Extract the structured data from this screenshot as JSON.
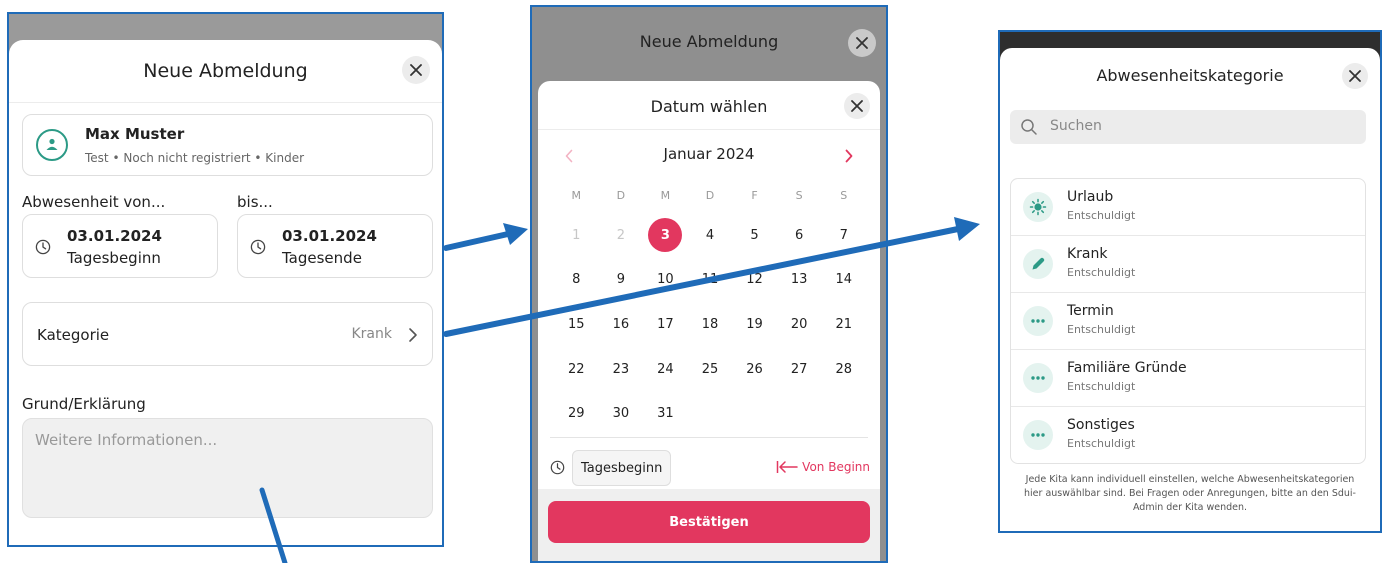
{
  "colors": {
    "accent": "#e2375f",
    "teal": "#2c9a86",
    "frame": "#1f6bb8"
  },
  "panel1": {
    "title": "Neue Abmeldung",
    "user": {
      "name": "Max Muster",
      "subtitle": "Test • Noch nicht registriert • Kinder"
    },
    "from_label": "Abwesenheit von...",
    "to_label": "bis...",
    "from": {
      "date": "03.01.2024",
      "time": "Tagesbeginn"
    },
    "to": {
      "date": "03.01.2024",
      "time": "Tagesende"
    },
    "category_label": "Kategorie",
    "category_value": "Krank",
    "reason_label": "Grund/Erklärung",
    "reason_placeholder": "Weitere Informationen..."
  },
  "panel2": {
    "background_title": "Neue Abmeldung",
    "title": "Datum wählen",
    "month": "Januar 2024",
    "weekdays": [
      "M",
      "D",
      "M",
      "D",
      "F",
      "S",
      "S"
    ],
    "days": [
      {
        "d": "1",
        "state": "muted"
      },
      {
        "d": "2",
        "state": "muted"
      },
      {
        "d": "3",
        "state": "selected"
      },
      {
        "d": "4"
      },
      {
        "d": "5"
      },
      {
        "d": "6"
      },
      {
        "d": "7"
      },
      {
        "d": "8"
      },
      {
        "d": "9"
      },
      {
        "d": "10"
      },
      {
        "d": "11"
      },
      {
        "d": "12"
      },
      {
        "d": "13"
      },
      {
        "d": "14"
      },
      {
        "d": "15"
      },
      {
        "d": "16"
      },
      {
        "d": "17"
      },
      {
        "d": "18"
      },
      {
        "d": "19"
      },
      {
        "d": "20"
      },
      {
        "d": "21"
      },
      {
        "d": "22"
      },
      {
        "d": "23"
      },
      {
        "d": "24"
      },
      {
        "d": "25"
      },
      {
        "d": "26"
      },
      {
        "d": "27"
      },
      {
        "d": "28"
      },
      {
        "d": "29"
      },
      {
        "d": "30"
      },
      {
        "d": "31"
      }
    ],
    "time_button": "Tagesbeginn",
    "from_start": "Von Beginn",
    "confirm": "Bestätigen"
  },
  "panel3": {
    "title": "Abwesenheitskategorie",
    "search_placeholder": "Suchen",
    "items": [
      {
        "title": "Urlaub",
        "subtitle": "Entschuldigt",
        "icon": "sun-icon"
      },
      {
        "title": "Krank",
        "subtitle": "Entschuldigt",
        "icon": "pencil-icon"
      },
      {
        "title": "Termin",
        "subtitle": "Entschuldigt",
        "icon": "dots-icon"
      },
      {
        "title": "Familiäre Gründe",
        "subtitle": "Entschuldigt",
        "icon": "dots-icon"
      },
      {
        "title": "Sonstiges",
        "subtitle": "Entschuldigt",
        "icon": "dots-icon"
      }
    ],
    "note": "Jede Kita kann individuell einstellen, welche Abwesenheitskategorien hier auswählbar sind. Bei Fragen oder Anregungen, bitte an den Sdui-Admin der Kita wenden."
  }
}
